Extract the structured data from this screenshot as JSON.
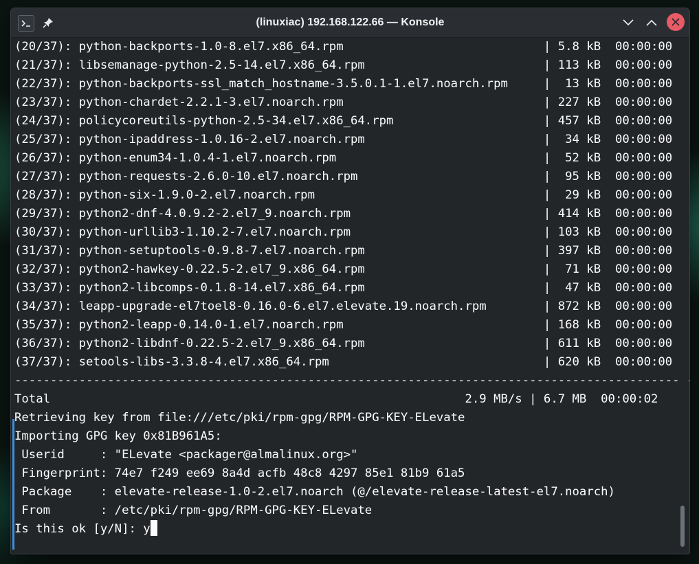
{
  "window": {
    "title": "(linuxiac) 192.168.122.66 — Konsole"
  },
  "icons": {
    "app": "terminal-icon",
    "pin": "pin-icon",
    "minimize": "chevron-down-icon",
    "maximize": "chevron-up-icon",
    "close": "close-icon"
  },
  "colors": {
    "close_button": "#e95a67",
    "terminal_bg": "#232629",
    "marker": "#3d8ee0"
  },
  "terminal": {
    "lines": [
      "(20/37): python-backports-1.0-8.el7.x86_64.rpm                            | 5.8 kB  00:00:00",
      "(21/37): libsemanage-python-2.5-14.el7.x86_64.rpm                         | 113 kB  00:00:00",
      "(22/37): python-backports-ssl_match_hostname-3.5.0.1-1.el7.noarch.rpm     |  13 kB  00:00:00",
      "(23/37): python-chardet-2.2.1-3.el7.noarch.rpm                            | 227 kB  00:00:00",
      "(24/37): policycoreutils-python-2.5-34.el7.x86_64.rpm                     | 457 kB  00:00:00",
      "(25/37): python-ipaddress-1.0.16-2.el7.noarch.rpm                         |  34 kB  00:00:00",
      "(26/37): python-enum34-1.0.4-1.el7.noarch.rpm                             |  52 kB  00:00:00",
      "(27/37): python-requests-2.6.0-10.el7.noarch.rpm                          |  95 kB  00:00:00",
      "(28/37): python-six-1.9.0-2.el7.noarch.rpm                                |  29 kB  00:00:00",
      "(29/37): python2-dnf-4.0.9.2-2.el7_9.noarch.rpm                           | 414 kB  00:00:00",
      "(30/37): python-urllib3-1.10.2-7.el7.noarch.rpm                           | 103 kB  00:00:00",
      "(31/37): python-setuptools-0.9.8-7.el7.noarch.rpm                         | 397 kB  00:00:00",
      "(32/37): python2-hawkey-0.22.5-2.el7_9.x86_64.rpm                         |  71 kB  00:00:00",
      "(33/37): python2-libcomps-0.1.8-14.el7.x86_64.rpm                         |  47 kB  00:00:00",
      "(34/37): leapp-upgrade-el7toel8-0.16.0-6.el7.elevate.19.noarch.rpm        | 872 kB  00:00:00",
      "(35/37): python2-leapp-0.14.0-1.el7.noarch.rpm                            | 168 kB  00:00:00",
      "(36/37): python2-libdnf-0.22.5-2.el7_9.x86_64.rpm                         | 611 kB  00:00:00",
      "(37/37): setools-libs-3.3.8-4.el7.x86_64.rpm                              | 620 kB  00:00:00",
      "-----------------------------------------------------------------------------------------------",
      "Total                                                          2.9 MB/s | 6.7 MB  00:00:02",
      "Retrieving key from file:///etc/pki/rpm-gpg/RPM-GPG-KEY-ELevate",
      "Importing GPG key 0x81B961A5:",
      " Userid     : \"ELevate <packager@almalinux.org>\"",
      " Fingerprint: 74e7 f249 ee69 8a4d acfb 48c8 4297 85e1 81b9 61a5",
      " Package    : elevate-release-1.0-2.el7.noarch (@/elevate-release-latest-el7.noarch)",
      " From       : /etc/pki/rpm-gpg/RPM-GPG-KEY-ELevate"
    ],
    "prompt": "Is this ok [y/N]: ",
    "input": "y"
  }
}
